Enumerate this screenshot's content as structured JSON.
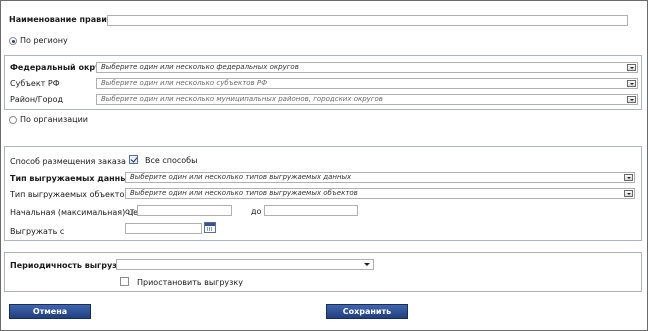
{
  "rule_name": {
    "label": "Наименование правила",
    "required": "*",
    "value": ""
  },
  "by_region": {
    "label": "По региону",
    "selected": true,
    "federal_district": {
      "label": "Федеральный округ",
      "required": "*",
      "placeholder": "Выберите один или несколько федеральных округов"
    },
    "subject": {
      "label": "Субъект РФ",
      "placeholder": "Выберите один или несколько субъектов РФ"
    },
    "district_city": {
      "label": "Район/Город",
      "placeholder": "Выберите один или несколько муниципальных районов, городских округов"
    }
  },
  "by_organization": {
    "label": "По организации",
    "selected": false
  },
  "placement": {
    "label": "Способ размещения заказа",
    "all_methods_label": "Все способы",
    "all_methods_checked": true
  },
  "data_type": {
    "label": "Тип выгружаемых данных",
    "required": "*",
    "placeholder": "Выберите один или несколько типов выгружаемых данных"
  },
  "object_type": {
    "label": "Тип выгружаемых объектов",
    "placeholder": "Выберите один или несколько типов выгружаемых объектов"
  },
  "price": {
    "label": "Начальная (максимальная) цена",
    "from_label": "от",
    "to_label": "до",
    "from_value": "",
    "to_value": ""
  },
  "export_from": {
    "label": "Выгружать с",
    "value": ""
  },
  "periodicity": {
    "label": "Периодичность выгрузки",
    "required": "*",
    "value": ""
  },
  "suspend": {
    "label": "Приостановить выгрузку",
    "checked": false
  },
  "buttons": {
    "cancel": "Отмена",
    "save": "Сохранить"
  },
  "colors": {
    "button": "#2c4d92",
    "required": "#d40000",
    "section_border": "#a9b4c4"
  }
}
